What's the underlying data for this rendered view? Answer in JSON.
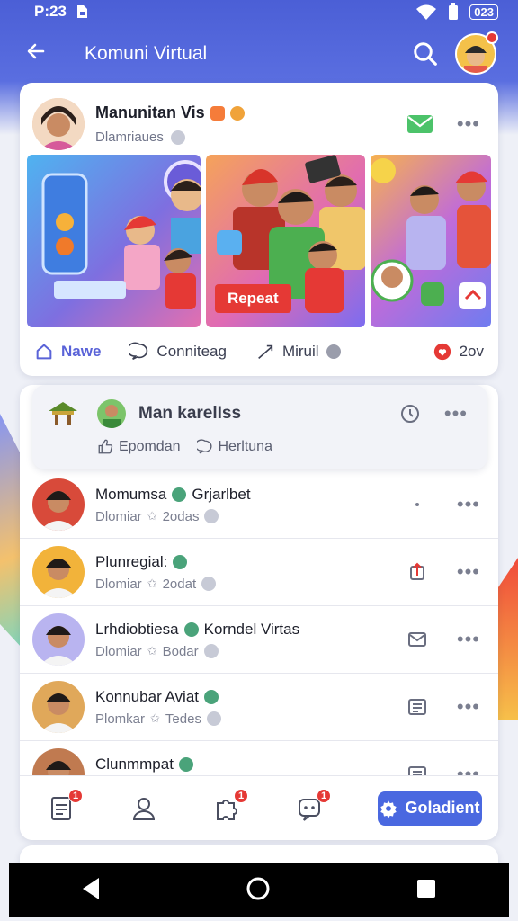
{
  "status_bar": {
    "time": "P:23",
    "battery": "023"
  },
  "app_bar": {
    "title": "Komuni Virtual"
  },
  "post": {
    "title": "Manunitan Vis",
    "subtitle": "Dlamriaues",
    "repeat_label": "Repeat",
    "actions": {
      "like": "Nawe",
      "comment": "Conniteag",
      "share": "Miruil",
      "count": "2ov"
    }
  },
  "group": {
    "name": "Man karelIss",
    "like_label": "Epomdan",
    "comment_label": "Herltuna"
  },
  "members": [
    {
      "name": "Momumsa",
      "extra": "Grjarlbet",
      "role": "Dlomiar",
      "time": "2odas",
      "action_icon": "more-icon",
      "avatar_bg": "#d84a3a"
    },
    {
      "name": "Plunregial:",
      "extra": "",
      "role": "Dlomiar",
      "time": "2odat",
      "action_icon": "share-box-icon",
      "avatar_bg": "#f2b33a"
    },
    {
      "name": "Lrhdiobtiesa",
      "extra": "Korndel Virtas",
      "role": "Dlomiar",
      "time": "Bodar",
      "action_icon": "mail-icon",
      "avatar_bg": "#b9b4f0"
    },
    {
      "name": "Konnubar Aviat",
      "extra": "",
      "role": "Plomkar",
      "time": "Tedes",
      "action_icon": "list-icon",
      "avatar_bg": "#e0a85a"
    },
    {
      "name": "Clunmmpat",
      "extra": "",
      "role": "",
      "time": "",
      "action_icon": "list-icon",
      "avatar_bg": "#c07a50"
    }
  ],
  "bottom_nav": {
    "badges": {
      "feed": "1",
      "chat": "1",
      "notifications": "1"
    },
    "cta_label": "Goladient"
  },
  "colors": {
    "primary": "#4a68e0",
    "accent_red": "#e53935"
  }
}
